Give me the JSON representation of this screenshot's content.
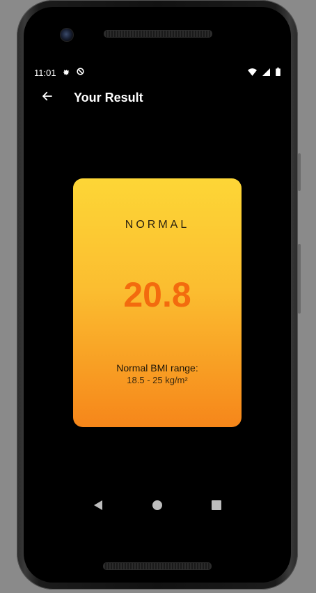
{
  "status_bar": {
    "time": "11:01",
    "left_icons": [
      "settings-gear-icon",
      "data-saver-icon"
    ],
    "right_icons": [
      "wifi-icon",
      "cell-signal-icon",
      "battery-icon"
    ]
  },
  "app_bar": {
    "back_icon": "arrow-back-icon",
    "title": "Your Result"
  },
  "result_card": {
    "category": "NORMAL",
    "bmi_value": "20.8",
    "range_label": "Normal BMI range:",
    "range_value": "18.5 - 25 kg/m²",
    "colors": {
      "gradient_top": "#fdd636",
      "gradient_bottom": "#f6861a",
      "value_color": "#f36b0e"
    }
  },
  "system_nav": {
    "items": [
      "back-triangle-icon",
      "home-circle-icon",
      "recents-square-icon"
    ]
  }
}
